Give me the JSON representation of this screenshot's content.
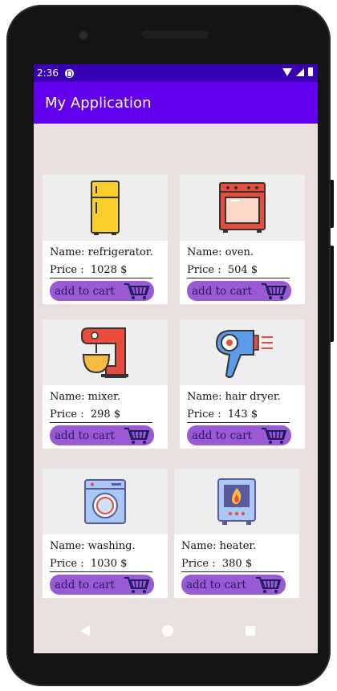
{
  "status_bar": {
    "time": "2:36"
  },
  "app_bar": {
    "title": "My Application"
  },
  "products": [
    {
      "name_label": "Name:",
      "name": "refrigerator.",
      "price_label": "Price :",
      "price": "1028 $",
      "button": "add to cart",
      "icon": "refrigerator-icon"
    },
    {
      "name_label": "Name:",
      "name": "oven.",
      "price_label": "Price :",
      "price": "504 $",
      "button": "add to cart",
      "icon": "oven-icon"
    },
    {
      "name_label": "Name:",
      "name": "mixer.",
      "price_label": "Price :",
      "price": "298 $",
      "button": "add to cart",
      "icon": "mixer-icon"
    },
    {
      "name_label": "Name:",
      "name": "hair dryer.",
      "price_label": "Price :",
      "price": "143 $",
      "button": "add to cart",
      "icon": "hair-dryer-icon"
    },
    {
      "name_label": "Name:",
      "name": "washing.",
      "price_label": "Price :",
      "price": "1030 $",
      "button": "add to cart",
      "icon": "washing-machine-icon"
    },
    {
      "name_label": "Name:",
      "name": "heater.",
      "price_label": "Price :",
      "price": "380 $",
      "button": "add to cart",
      "icon": "heater-icon"
    }
  ],
  "colors": {
    "status_bar": "#3700b3",
    "app_bar": "#6200ee",
    "background": "#e8dfde",
    "button": "#9a5ad6"
  },
  "nav_bar": {
    "back": "back-icon",
    "home": "home-icon",
    "recents": "recents-icon"
  }
}
